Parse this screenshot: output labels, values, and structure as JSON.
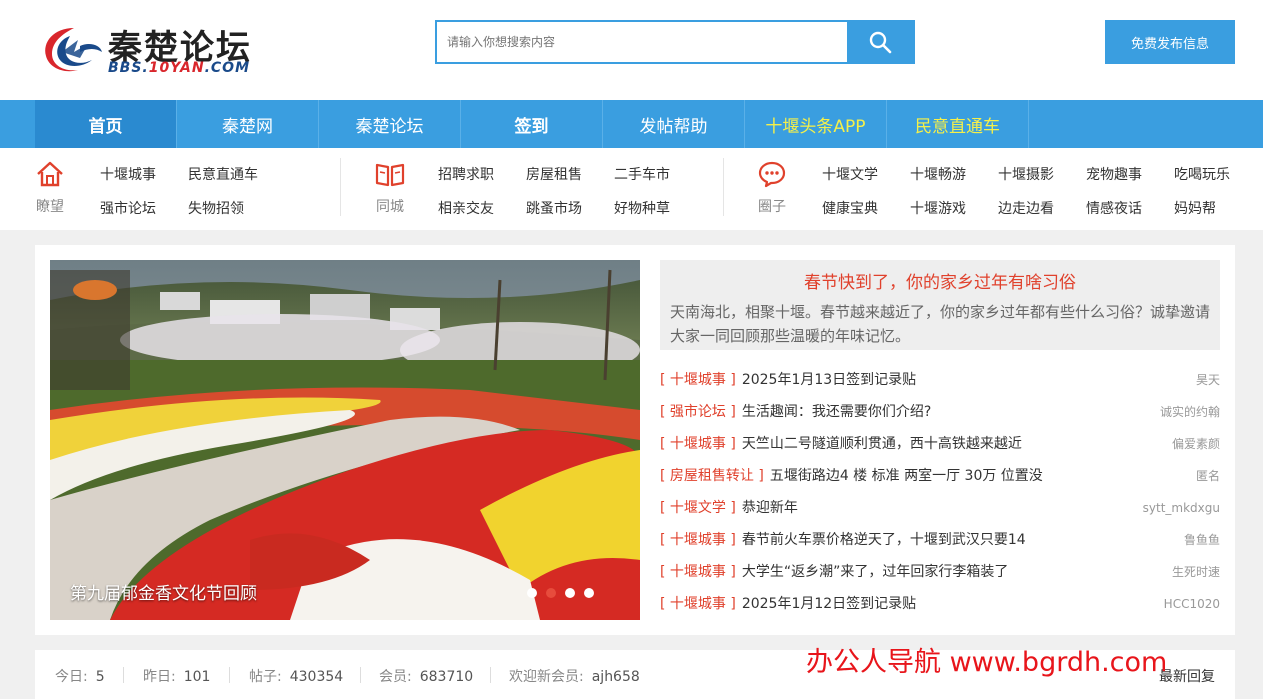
{
  "header": {
    "logo_title": "秦楚论坛",
    "logo_sub_a": "BBS.",
    "logo_sub_b": "10YAN",
    "logo_sub_c": ".COM",
    "search_placeholder": "请输入你想搜索内容",
    "post_button": "免费发布信息"
  },
  "nav": [
    "首页",
    "秦楚网",
    "秦楚论坛",
    "签到",
    "发帖帮助",
    "十堰头条APP",
    "民意直通车"
  ],
  "categories": {
    "group1": {
      "label": "瞭望",
      "icon": "home-icon",
      "links": [
        "十堰城事",
        "民意直通车",
        "强市论坛",
        "失物招领"
      ]
    },
    "group2": {
      "label": "同城",
      "icon": "book-icon",
      "links": [
        "招聘求职",
        "房屋租售",
        "二手车市",
        "相亲交友",
        "跳蚤市场",
        "好物种草"
      ]
    },
    "group3": {
      "label": "圈子",
      "icon": "chat-icon",
      "links": [
        "十堰文学",
        "十堰畅游",
        "十堰摄影",
        "宠物趣事",
        "吃喝玩乐",
        "健康宝典",
        "十堰游戏",
        "边走边看",
        "情感夜话",
        "妈妈帮"
      ]
    }
  },
  "slider": {
    "caption": "第九届郁金香文化节回顾",
    "dots": 4,
    "active_dot": 1
  },
  "feature": {
    "title": "春节快到了，你的家乡过年有啥习俗",
    "desc": "天南海北，相聚十堰。春节越来越近了，你的家乡过年都有些什么习俗？诚挚邀请大家一同回顾那些温暖的年味记忆。"
  },
  "news": [
    {
      "cat": "[ 十堰城事 ]",
      "title": "2025年1月13日签到记录贴",
      "author": "昊天"
    },
    {
      "cat": "[ 强市论坛 ]",
      "title": "生活趣闻：我还需要你们介绍?",
      "author": "诚实的约翰"
    },
    {
      "cat": "[ 十堰城事 ]",
      "title": "天竺山二号隧道顺利贯通，西十高铁越来越近",
      "author": "偏爱素颜"
    },
    {
      "cat": "[ 房屋租售转让 ]",
      "title": "五堰街路边4 楼 标准 两室一厅 30万 位置没",
      "author": "匿名"
    },
    {
      "cat": "[ 十堰文学 ]",
      "title": "恭迎新年",
      "author": "sytt_mkdxgu"
    },
    {
      "cat": "[ 十堰城事 ]",
      "title": "春节前火车票价格逆天了，十堰到武汉只要14",
      "author": "鲁鱼鱼"
    },
    {
      "cat": "[ 十堰城事 ]",
      "title": "大学生“返乡潮”来了，过年回家行李箱装了",
      "author": "生死时速"
    },
    {
      "cat": "[ 十堰城事 ]",
      "title": "2025年1月12日签到记录贴",
      "author": "HCC1020"
    }
  ],
  "stats": {
    "today_label": "今日:",
    "today": "5",
    "yesterday_label": "昨日:",
    "yesterday": "101",
    "posts_label": "帖子:",
    "posts": "430354",
    "members_label": "会员:",
    "members": "683710",
    "newest_label": "欢迎新会员:",
    "newest": "ajh658",
    "latest_reply": "最新回复"
  },
  "watermark": "办公人导航 www.bgrdh.com",
  "colors": {
    "primary": "#3a9ee0",
    "accent_red": "#e0412c",
    "nav_yellow": "#f5f04a"
  }
}
